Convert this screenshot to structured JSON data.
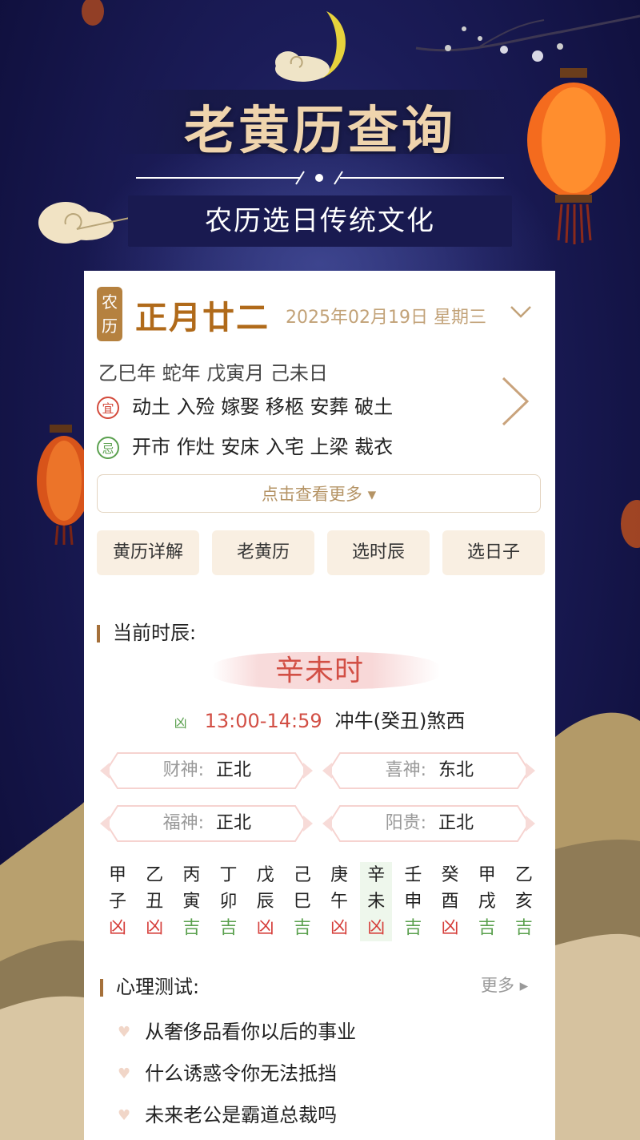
{
  "header": {
    "title": "老黄历查询",
    "subtitle": "农历选日传统文化"
  },
  "date": {
    "badge_top": "农",
    "badge_bottom": "历",
    "lunar": "正月廿二",
    "solar": "2025年02月19日 星期三",
    "ganzhi": "乙巳年 蛇年 戊寅月 己未日",
    "yi_mark": "宜",
    "ji_mark": "忌",
    "yi": "动土 入殓 嫁娶 移柩 安葬 破土",
    "ji": "开市 作灶 安床 入宅 上梁 裁衣",
    "more": "点击查看更多 ▾"
  },
  "tabs": [
    "黄历详解",
    "老黄历",
    "选时辰",
    "选日子"
  ],
  "current_hour": {
    "heading": "当前时辰:",
    "name": "辛未时",
    "mark": "凶",
    "time": "13:00-14:59",
    "clash": "冲牛(癸丑)煞西",
    "gods": [
      {
        "label": "财神:",
        "value": "正北"
      },
      {
        "label": "喜神:",
        "value": "东北"
      },
      {
        "label": "福神:",
        "value": "正北"
      },
      {
        "label": "阳贵:",
        "value": "正北"
      }
    ]
  },
  "hours": [
    {
      "stem": "甲",
      "branch": "子",
      "luck": "凶"
    },
    {
      "stem": "乙",
      "branch": "丑",
      "luck": "凶"
    },
    {
      "stem": "丙",
      "branch": "寅",
      "luck": "吉"
    },
    {
      "stem": "丁",
      "branch": "卯",
      "luck": "吉"
    },
    {
      "stem": "戊",
      "branch": "辰",
      "luck": "凶"
    },
    {
      "stem": "己",
      "branch": "巳",
      "luck": "吉"
    },
    {
      "stem": "庚",
      "branch": "午",
      "luck": "凶"
    },
    {
      "stem": "辛",
      "branch": "未",
      "luck": "凶"
    },
    {
      "stem": "壬",
      "branch": "申",
      "luck": "吉"
    },
    {
      "stem": "癸",
      "branch": "酉",
      "luck": "凶"
    },
    {
      "stem": "甲",
      "branch": "戌",
      "luck": "吉"
    },
    {
      "stem": "乙",
      "branch": "亥",
      "luck": "吉"
    }
  ],
  "psych": {
    "heading": "心理测试:",
    "more": "更多 ▸",
    "items": [
      "从奢侈品看你以后的事业",
      "什么诱惑令你无法抵挡",
      "未来老公是霸道总裁吗"
    ]
  }
}
